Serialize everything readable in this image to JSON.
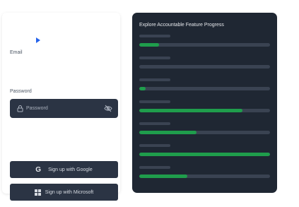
{
  "form": {
    "email_label": "Email",
    "password_label": "Password",
    "password_placeholder": "Password",
    "google_button": "Sign up with Google",
    "microsoft_button": "Sign up with Microsoft"
  },
  "progress_panel": {
    "title": "Explore Accountable Feature Progress",
    "fill_color": "#1f9d4c",
    "track_color": "#3a4352",
    "rows": [
      {
        "progress": 0.15
      },
      {
        "progress": 0.0
      },
      {
        "progress": 0.05
      },
      {
        "progress": 0.79
      },
      {
        "progress": 0.44
      },
      {
        "progress": 1.0
      },
      {
        "progress": 0.37
      }
    ]
  },
  "icons": {
    "play": "play-icon",
    "lock": "lock-icon",
    "eye_off": "eye-off-icon",
    "google": "google-icon",
    "microsoft": "microsoft-icon"
  }
}
